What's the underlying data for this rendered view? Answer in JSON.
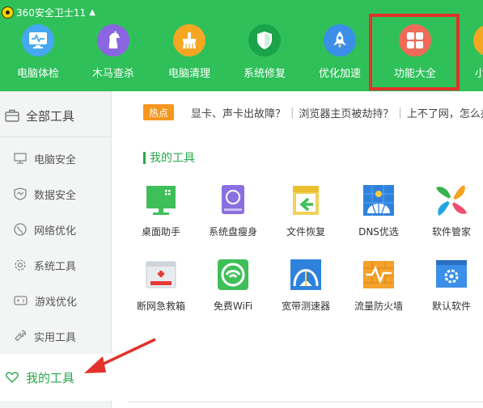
{
  "app": {
    "title": "360安全卫士11",
    "update_icon": "up-arrow-icon"
  },
  "nav": [
    {
      "label": "电脑体检",
      "icon": "monitor-icon",
      "color": "#45a8f0"
    },
    {
      "label": "木马查杀",
      "icon": "horse-icon",
      "color": "#8a66e0"
    },
    {
      "label": "电脑清理",
      "icon": "broom-icon",
      "color": "#f5a623"
    },
    {
      "label": "系统修复",
      "icon": "shield-icon",
      "color": "#1aa34a"
    },
    {
      "label": "优化加速",
      "icon": "rocket-icon",
      "color": "#3b8fe8"
    },
    {
      "label": "功能大全",
      "icon": "grid-icon",
      "color": "#f06a5a"
    },
    {
      "label": "小",
      "icon": "partial-icon",
      "color": "#f5a623"
    }
  ],
  "sidebar": {
    "header": "全部工具",
    "items": [
      {
        "label": "电脑安全",
        "icon": "computer-security-icon"
      },
      {
        "label": "数据安全",
        "icon": "data-shield-icon"
      },
      {
        "label": "网络优化",
        "icon": "globe-icon"
      },
      {
        "label": "系统工具",
        "icon": "gear-icon"
      },
      {
        "label": "游戏优化",
        "icon": "gamepad-icon"
      },
      {
        "label": "实用工具",
        "icon": "wrench-icon"
      }
    ],
    "active": {
      "label": "我的工具",
      "icon": "heart-icon"
    }
  },
  "hot": {
    "badge": "热点",
    "links": [
      "显卡、声卡出故障？",
      "浏览器主页被劫持？",
      "上不了网，怎么办"
    ]
  },
  "my_tools": {
    "title": "我的工具",
    "tools": [
      {
        "label": "桌面助手",
        "icon": "desktop-assistant-icon"
      },
      {
        "label": "系统盘瘦身",
        "icon": "disk-slim-icon"
      },
      {
        "label": "文件恢复",
        "icon": "file-recovery-icon"
      },
      {
        "label": "DNS优选",
        "icon": "dns-icon"
      },
      {
        "label": "软件管家",
        "icon": "software-manager-icon"
      },
      {
        "label": "断网急救箱",
        "icon": "first-aid-kit-icon"
      },
      {
        "label": "免费WiFi",
        "icon": "wifi-icon"
      },
      {
        "label": "宽带测速器",
        "icon": "speedometer-icon"
      },
      {
        "label": "流量防火墙",
        "icon": "firewall-icon"
      },
      {
        "label": "默认软件",
        "icon": "default-software-icon"
      }
    ]
  },
  "accent_colors": {
    "top_bar": "#2fc05a",
    "highlight": "#e2322b",
    "active_text": "#2aa74c",
    "hot_badge": "#f7961e"
  }
}
